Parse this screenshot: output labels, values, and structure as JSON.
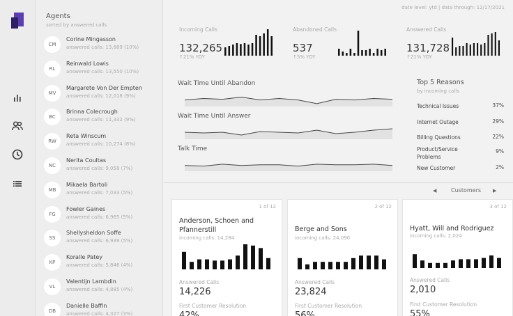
{
  "rail": {
    "icons": [
      "logo-icon",
      "bar-chart-icon",
      "people-icon",
      "clock-icon",
      "list-icon"
    ],
    "colors": {
      "logo_light": "#5b3fb0",
      "logo_dark": "#2c1f63"
    }
  },
  "agents": {
    "title": "Agents",
    "subtitle": "sorted by answered calls",
    "items": [
      {
        "initials": "CM",
        "name": "Corine Mingasson",
        "calls": "answered calls: 13,689 (10%)"
      },
      {
        "initials": "RL",
        "name": "Reinwald Lowis",
        "calls": "answered calls: 13,550 (10%)"
      },
      {
        "initials": "MV",
        "name": "Margarete Von Der Empten",
        "calls": "answered calls: 12,018 (9%)"
      },
      {
        "initials": "BC",
        "name": "Brinna Colecrough",
        "calls": "answered calls: 11,332 (9%)"
      },
      {
        "initials": "RW",
        "name": "Reta Winscum",
        "calls": "answered calls: 10,274 (8%)"
      },
      {
        "initials": "NC",
        "name": "Nerita Coultas",
        "calls": "answered calls: 9,058 (7%)"
      },
      {
        "initials": "MB",
        "name": "Mikaela Bartoli",
        "calls": "answered calls: 7,033 (5%)"
      },
      {
        "initials": "FG",
        "name": "Fowler Gaines",
        "calls": "answered calls: 6,965 (5%)"
      },
      {
        "initials": "SS",
        "name": "Shellysheldon Soffe",
        "calls": "answered calls: 6,939 (5%)"
      },
      {
        "initials": "KP",
        "name": "Koralle Patey",
        "calls": "answered calls: 5,846 (4%)"
      },
      {
        "initials": "VL",
        "name": "Valentijn Lambdin",
        "calls": "answered calls: 4,885 (4%)"
      },
      {
        "initials": "DB",
        "name": "Danielle Baffin",
        "calls": "answered calls: 4,327 (3%)"
      }
    ]
  },
  "header": {
    "date_line": "date level: ytd | data through: 12/17/2021"
  },
  "kpis": [
    {
      "label": "Incoming Calls",
      "value": "132,265",
      "yoy": "↑21% YOY",
      "bars": [
        0.3,
        0.35,
        0.4,
        0.45,
        0.42,
        0.45,
        0.4,
        0.45,
        0.75,
        0.7,
        0.8,
        0.95,
        0.7
      ]
    },
    {
      "label": "Abandoned Calls",
      "value": "537",
      "yoy": "↑5% YOY",
      "bars": [
        0.25,
        0.15,
        0.1,
        0.25,
        0.1,
        0.9,
        0.2,
        0.2,
        0.25,
        0.1,
        0.25,
        0.2,
        0.25
      ]
    },
    {
      "label": "Answered Calls",
      "value": "131,728",
      "yoy": "↑21% YOY",
      "bars": [
        0.65,
        0.3,
        0.35,
        0.35,
        0.45,
        0.4,
        0.45,
        0.45,
        0.4,
        0.45,
        0.75,
        0.8,
        0.85,
        0.55
      ]
    }
  ],
  "wait_charts": [
    {
      "label": "Wait Time Until Abandon",
      "points": [
        0.35,
        0.45,
        0.4,
        0.55,
        0.35,
        0.45,
        0.35,
        0.1,
        0.4,
        0.35,
        0.45,
        0.4
      ]
    },
    {
      "label": "Wait Time Until Answer",
      "points": [
        0.4,
        0.35,
        0.4,
        0.2,
        0.45,
        0.4,
        0.35,
        0.55,
        0.3,
        0.4,
        0.55,
        0.65
      ]
    },
    {
      "label": "Talk Time",
      "points": [
        0.35,
        0.3,
        0.45,
        0.35,
        0.4,
        0.4,
        0.3,
        0.45,
        0.4,
        0.4,
        0.45,
        0.35
      ]
    }
  ],
  "reasons": {
    "title": "Top 5 Reasons",
    "subtitle": "by incoming calls",
    "items": [
      {
        "name": "Technical Issues",
        "pct": "37%"
      },
      {
        "name": "Internet Outage",
        "pct": "29%"
      },
      {
        "name": "Billing Questions",
        "pct": "22%"
      },
      {
        "name": "Product/Service Problems",
        "pct": "9%"
      },
      {
        "name": "New Customer",
        "pct": "2%"
      }
    ]
  },
  "customers_nav": {
    "prev": "◀",
    "label": "Customers",
    "next": "▶"
  },
  "customers": [
    {
      "num": "1 of 12",
      "name": "Anderson, Schoen and Pfannerstill",
      "incoming": "incoming calls: 14,284",
      "answered_label": "Answered Calls",
      "answered": "14,226",
      "fcr_label": "First Customer Resolution",
      "fcr": "42%",
      "bars": [
        0.7,
        0.3,
        0.4,
        0.4,
        0.35,
        0.35,
        0.4,
        0.55,
        1.0,
        0.95,
        0.85,
        0.45
      ]
    },
    {
      "num": "2 of 12",
      "name": "Berge and Sons",
      "incoming": "incoming calls: 24,090",
      "answered_label": "Answered Calls",
      "answered": "23,824",
      "fcr_label": "First Customer Resolution",
      "fcr": "56%",
      "bars": [
        0.45,
        0.2,
        0.3,
        0.3,
        0.3,
        0.3,
        0.3,
        0.45,
        0.55,
        0.55,
        0.55,
        0.4
      ]
    },
    {
      "num": "3 of 12",
      "name": "Hyatt, Will and Rodriguez",
      "incoming": "incoming calls: 2,024",
      "answered_label": "Answered Calls",
      "answered": "2,010",
      "fcr_label": "First Customer Resolution",
      "fcr": "55%",
      "bars": [
        0.55,
        0.3,
        0.2,
        0.2,
        0.2,
        0.3,
        0.35,
        0.35,
        0.35,
        0.4,
        0.5,
        0.4
      ]
    }
  ]
}
